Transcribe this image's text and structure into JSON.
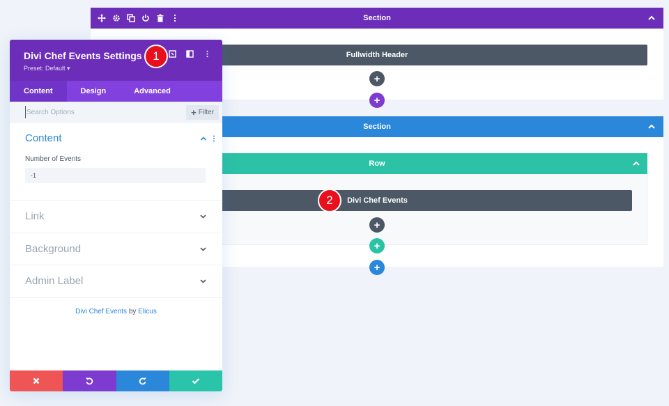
{
  "builder": {
    "section1": {
      "label": "Section",
      "color": "#6c2eb9"
    },
    "fullwidth_module": {
      "label": "Fullwidth Header"
    },
    "section2": {
      "label": "Section",
      "color": "#2b87da"
    },
    "row": {
      "label": "Row",
      "color": "#2bc2a5"
    },
    "chef_module": {
      "label": "Divi Chef Events"
    },
    "add_symbol": "+"
  },
  "badges": {
    "one": "1",
    "two": "2"
  },
  "panel": {
    "title": "Divi Chef Events Settings",
    "preset": "Preset: Default ▾",
    "tabs": [
      "Content",
      "Design",
      "Advanced"
    ],
    "search_placeholder": "Search Options",
    "filter_label": "Filter",
    "filter_symbol": "+",
    "content_group": {
      "title": "Content",
      "field_label": "Number of Events",
      "field_value": "-1"
    },
    "groups": [
      "Link",
      "Background",
      "Admin Label"
    ],
    "credit": {
      "product": "Divi Chef Events",
      "by": " by ",
      "author": "Elicus"
    }
  },
  "colors": {
    "cancel": "#ef5555",
    "undo": "#7e3bd0",
    "redo": "#2b87da",
    "save": "#29c4a9"
  }
}
